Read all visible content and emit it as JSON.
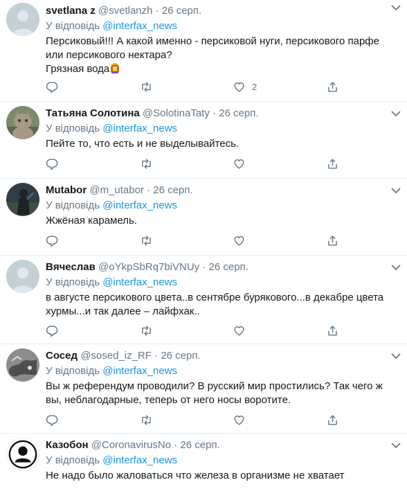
{
  "reply_prefix": "У відповідь",
  "reply_mention": "@interfax_news",
  "separator": "·",
  "tweets": [
    {
      "name": "svetlana z",
      "handle": "@svetlanzh",
      "date": "26 серп.",
      "lines": [
        "Персиковый!!! А какой именно - персиковой нуги, персикового парфе",
        "или персикового нектара?",
        "Грязная вода"
      ],
      "emoji": "woman-facepalming-emoji",
      "like_count": "2",
      "avatar": "default-avatar"
    },
    {
      "name": "Татьяна Солотина",
      "handle": "@SolotinaTaty",
      "date": "26 серп.",
      "lines": [
        "Пейте то, что есть и не выделывайтесь."
      ],
      "like_count": "",
      "avatar": "cat-photo-avatar"
    },
    {
      "name": "Mutabor",
      "handle": "@m_utabor",
      "date": "26 серп.",
      "lines": [
        "Жжёная карамель."
      ],
      "like_count": "",
      "avatar": "dark-figure-avatar"
    },
    {
      "name": "Вячеслав",
      "handle": "@oYkpSbRq7biVNUy",
      "date": "26 серп.",
      "lines": [
        "в августе персикового цвета..в сентябре бурякового...в декабре цвета",
        "хурмы...и так далее – лайфхак.."
      ],
      "like_count": "",
      "avatar": "default-avatar"
    },
    {
      "name": "Сосед",
      "handle": "@sosed_iz_RF",
      "date": "26 серп.",
      "lines": [
        "Вы ж референдум проводили? В русский мир простились? Так чего ж",
        "вы, неблагодарные, теперь от него носы воротите."
      ],
      "like_count": "",
      "avatar": "grey-map-avatar"
    },
    {
      "name": "Казобон",
      "handle": "@CoronavirusNo",
      "date": "26 серп.",
      "lines": [
        "Не надо было жаловаться что железа в организме не хватает"
      ],
      "like_count": "",
      "avatar": "silhouette-avatar"
    }
  ],
  "colors": {
    "text": "#14171a",
    "secondary": "#657786",
    "mention": "#1b95e0",
    "border": "#e6ecf0",
    "icon": "#657786",
    "default_avatar_bg": "#c4cfd6"
  }
}
